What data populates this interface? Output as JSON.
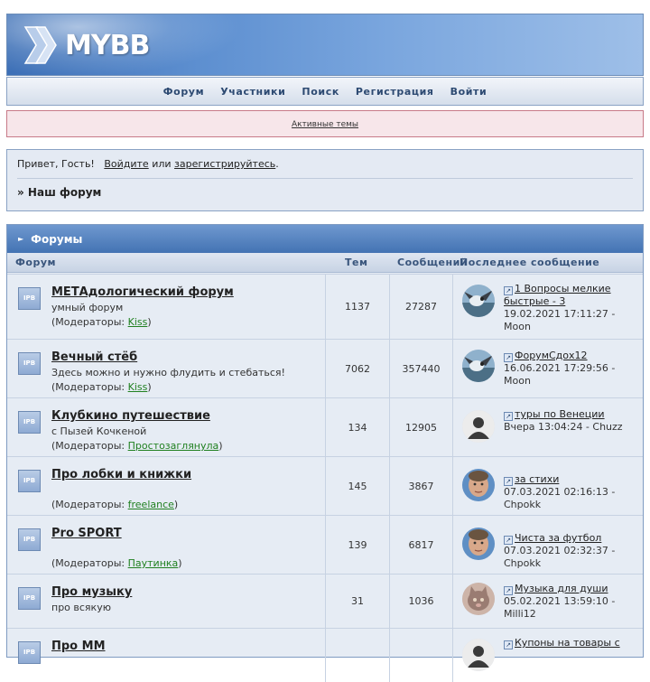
{
  "logo": {
    "text": "MYBB"
  },
  "nav": [
    "Форум",
    "Участники",
    "Поиск",
    "Регистрация",
    "Войти"
  ],
  "announcement": "Активные темы",
  "welcome": {
    "greeting": "Привет, Гость!",
    "login_link": "Войдите",
    "or": "или",
    "register_link": "зарегистрируйтесь",
    "period": ".",
    "breadcrumb": "» Наш форум"
  },
  "forums": {
    "section_title": "Форумы",
    "columns": {
      "forum": "Форум",
      "topics": "Тем",
      "posts": "Сообщений",
      "last_post": "Последнее сообщение"
    },
    "icon_label": "IPB",
    "moderators_prefix": "(Модераторы: ",
    "moderators_suffix": ")",
    "rows": [
      {
        "title": "МЕТАдологический форум",
        "desc": "умный форум",
        "moderator": "Kiss",
        "topics": "1137",
        "posts": "27287",
        "last_title": "1 Вопросы мелкие быстрые - 3",
        "last_meta": "19.02.2021 17:11:27 - Moon",
        "avatar": "bird"
      },
      {
        "title": "Вечный стёб",
        "desc": "Здесь можно и нужно флудить и стебаться!",
        "moderator": "Kiss",
        "topics": "7062",
        "posts": "357440",
        "last_title": "ФорумСдох12",
        "last_meta": "16.06.2021 17:29:56 - Moon",
        "avatar": "bird"
      },
      {
        "title": "Клубкино путешествие",
        "desc": "с Пызей Кочкеной",
        "moderator": "Простозаглянула",
        "topics": "134",
        "posts": "12905",
        "last_title": "туры по Венеции",
        "last_meta": "Вчера 13:04:24 - Chuzz",
        "avatar": "default"
      },
      {
        "title": "Про лобки и книжки",
        "desc": "",
        "moderator": "freelance",
        "topics": "145",
        "posts": "3867",
        "last_title": "за стихи",
        "last_meta": "07.03.2021 02:16:13 - Chpokk",
        "avatar": "face"
      },
      {
        "title": "Pro SPORT",
        "desc": "",
        "moderator": "Паутинка",
        "topics": "139",
        "posts": "6817",
        "last_title": "Чиста за футбол",
        "last_meta": "07.03.2021 02:32:37 - Chpokk",
        "avatar": "face"
      },
      {
        "title": "Про музыку",
        "desc": "про всякую",
        "moderator": "",
        "topics": "31",
        "posts": "1036",
        "last_title": "Музыка для души",
        "last_meta": "05.02.2021 13:59:10 - Milli12",
        "avatar": "cat"
      },
      {
        "title": "Про ММ",
        "desc": "",
        "moderator": "",
        "topics": "",
        "posts": "",
        "last_title": "Купоны на товары с",
        "last_meta": "",
        "avatar": "default"
      }
    ]
  }
}
